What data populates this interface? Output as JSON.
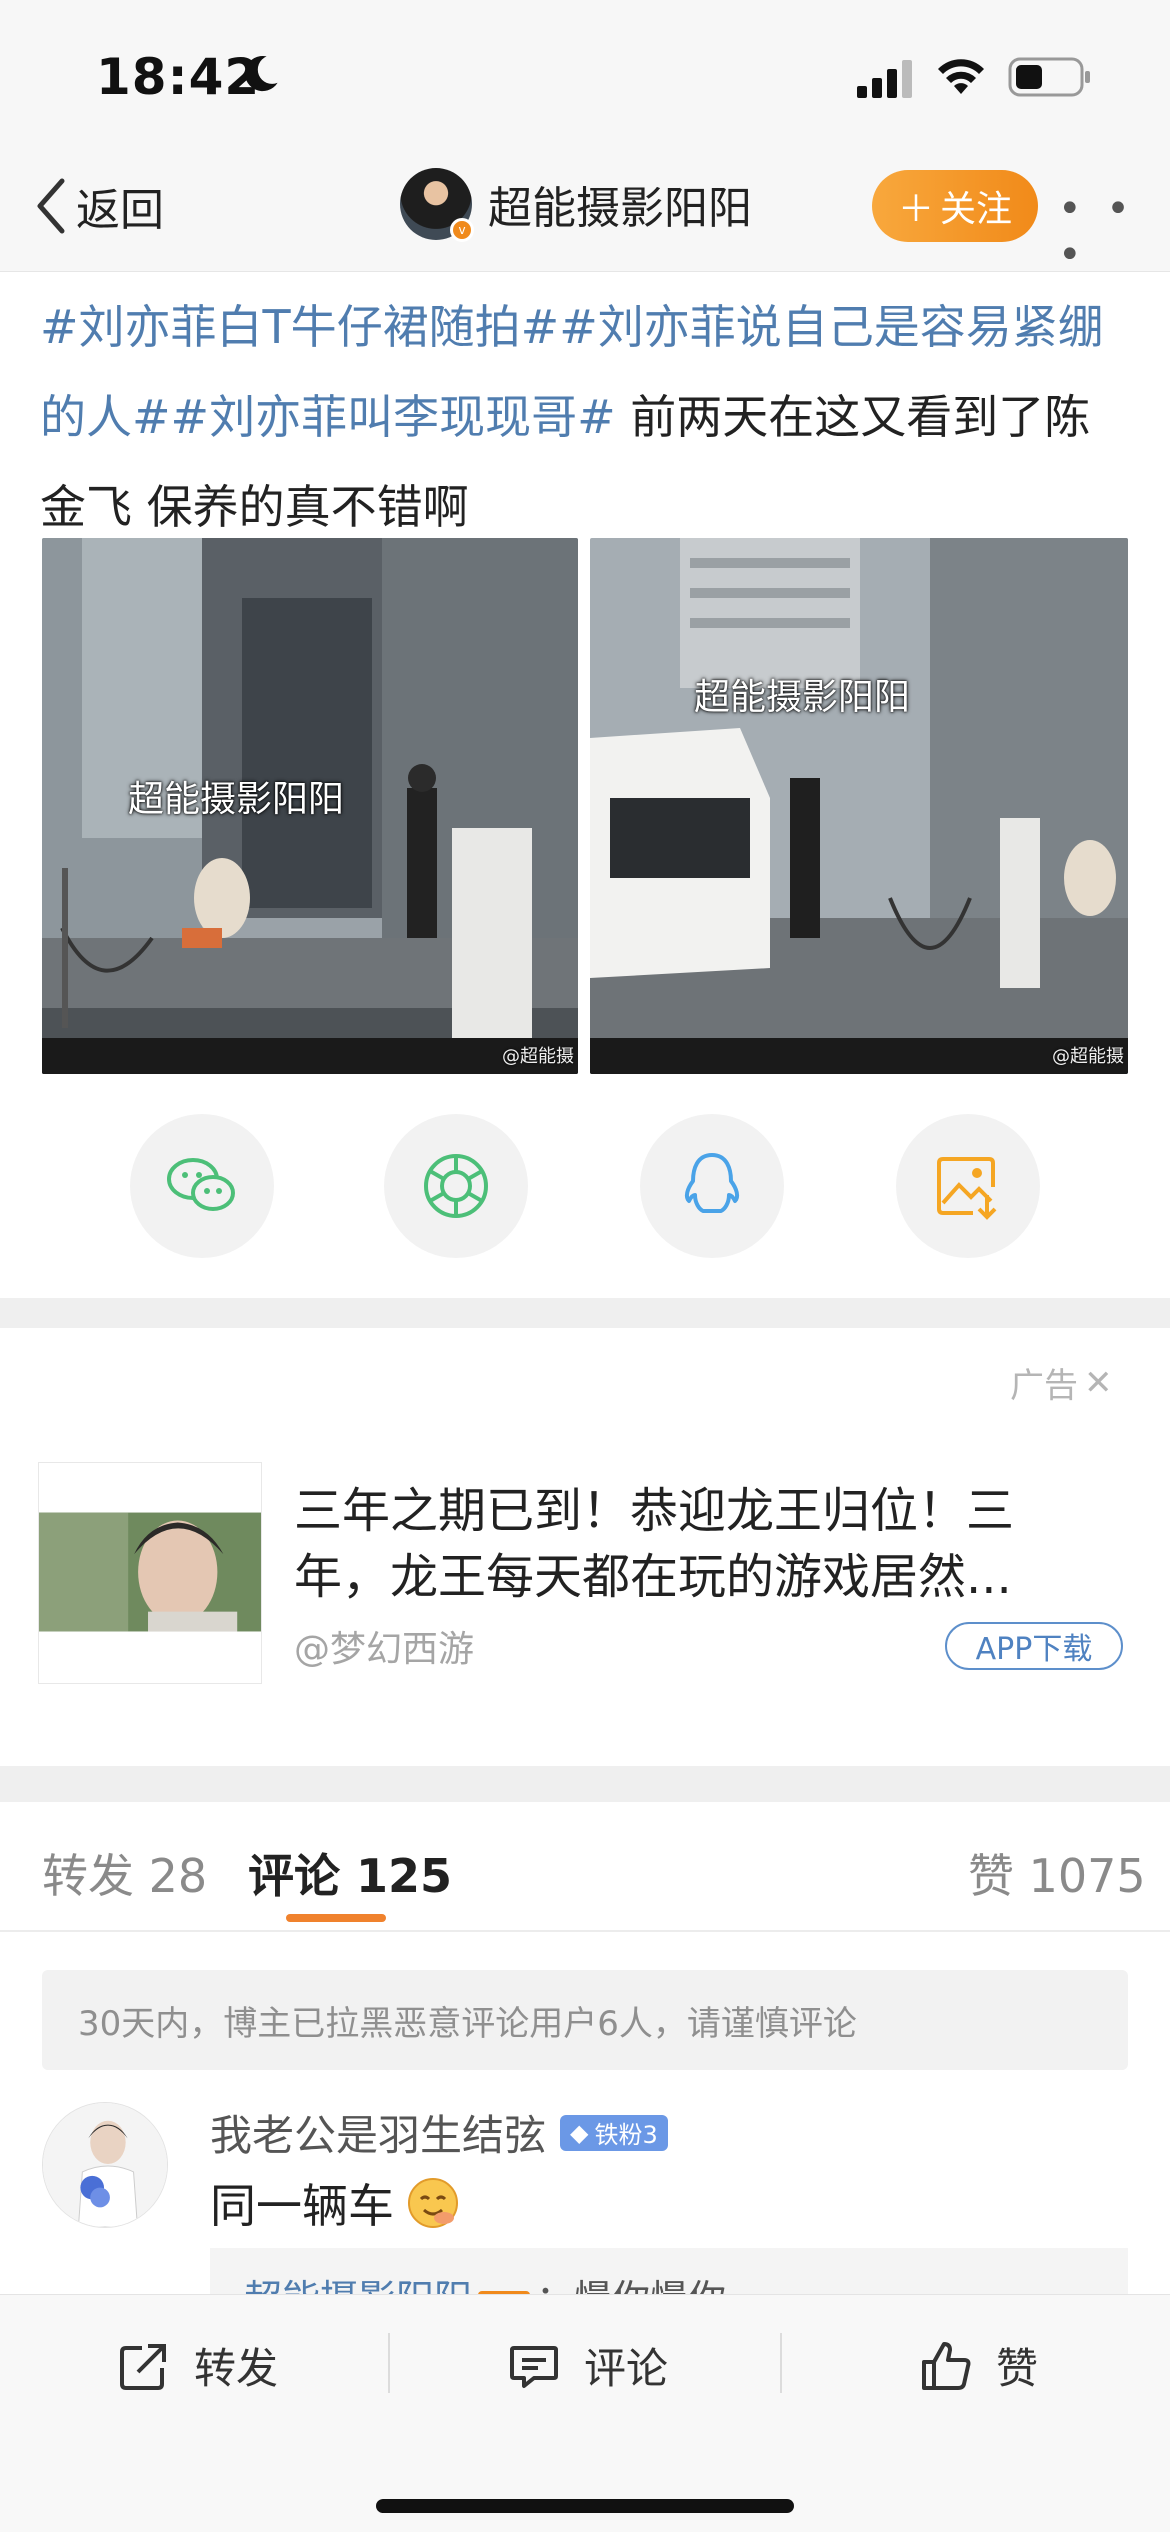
{
  "status_bar": {
    "time": "18:42"
  },
  "nav": {
    "back_label": "返回",
    "author_name": "超能摄影阳阳",
    "follow_label": "关注",
    "more_label": "• • •"
  },
  "post": {
    "tags": [
      "#刘亦菲白T牛仔裙随拍#",
      "#刘亦菲说自己是容易紧绷的人#",
      "#刘亦菲叫李现现哥#"
    ],
    "text": " 前两天在这又看到了陈金飞 保养的真不错啊",
    "image_watermark": "超能摄影阳阳",
    "image_small_watermark": "@超能摄"
  },
  "share": [
    {
      "name": "wechat-icon",
      "color": "#4cbf78"
    },
    {
      "name": "moments-icon",
      "color": "#4cbf78"
    },
    {
      "name": "qq-icon",
      "color": "#4aa3e8"
    },
    {
      "name": "save-image-icon",
      "color": "#f5a623"
    }
  ],
  "ad": {
    "label": "广告",
    "title": "三年之期已到！恭迎龙王归位！三年，龙王每天都在玩的游戏居然...",
    "source": "@梦幻西游",
    "button": "APP下载"
  },
  "tabs": {
    "repost": "转发 28",
    "comment": "评论 125",
    "like": "赞 1075"
  },
  "notice": "30天内，博主已拉黑恶意评论用户6人，请谨慎评论",
  "comment": {
    "user": "我老公是羽生结弦",
    "badge": "铁粉3",
    "text": "同一辆车",
    "reply_name": "超能摄影阳阳",
    "reply_owner": "博主",
    "reply_text": "：慢你慢你"
  },
  "bottom_bar": {
    "repost": "转发",
    "comment": "评论",
    "like": "赞"
  },
  "colors": {
    "accent": "#f18a19",
    "topic_link": "#507daf"
  }
}
